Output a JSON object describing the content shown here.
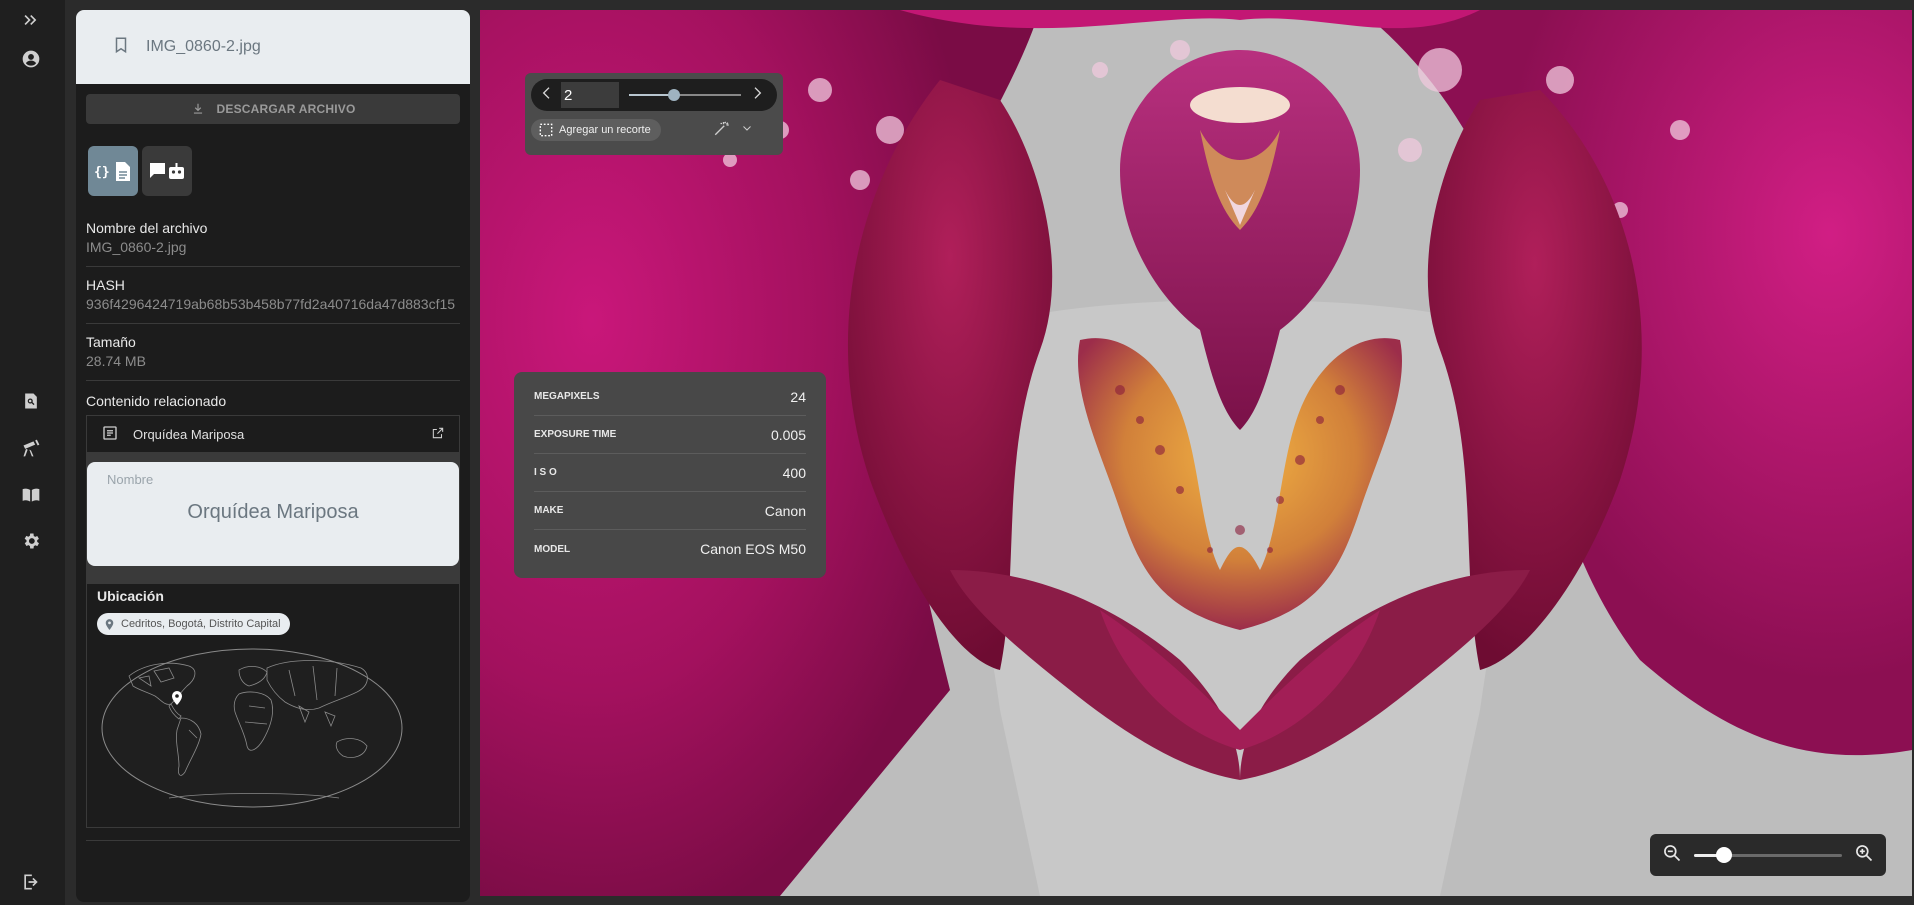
{
  "rail": {
    "icons": [
      "expand-icon",
      "account-icon",
      "search-document-icon",
      "telescope-icon",
      "book-icon",
      "gear-icon",
      "logout-icon"
    ]
  },
  "file": {
    "title": "IMG_0860-2.jpg",
    "download_label": "DESCARGAR ARCHIVO",
    "view_json_label": "{}",
    "fields": [
      {
        "label": "Nombre del archivo",
        "value": "IMG_0860-2.jpg"
      },
      {
        "label": "HASH",
        "value": "936f4296424719ab68b53b458b77fd2a40716da47d883cf15"
      },
      {
        "label": "Tamaño",
        "value": "28.74 MB"
      }
    ],
    "related_title": "Contenido relacionado",
    "related_item": "Orquídea Mariposa",
    "name_label": "Nombre",
    "name_value": "Orquídea Mariposa",
    "location_title": "Ubicación",
    "location_chip": "Cedritos, Bogotá, Distrito Capital"
  },
  "toolbar": {
    "page_value": "2",
    "page_slider": 0.4,
    "crop_label": "Agregar un recorte"
  },
  "exif": [
    {
      "key": "MEGAPIXELS",
      "value": "24"
    },
    {
      "key": "EXPOSURE TIME",
      "value": "0.005"
    },
    {
      "key": "I S O",
      "value": "400"
    },
    {
      "key": "MAKE",
      "value": "Canon"
    },
    {
      "key": "MODEL",
      "value": "Canon EOS M50"
    }
  ],
  "zoom": {
    "level": 0.2
  },
  "colors": {
    "accent": "#708896",
    "panel_bg": "#1c1c1c",
    "card_bg": "#e9edf0",
    "orchid_magenta": "#c2166f"
  }
}
